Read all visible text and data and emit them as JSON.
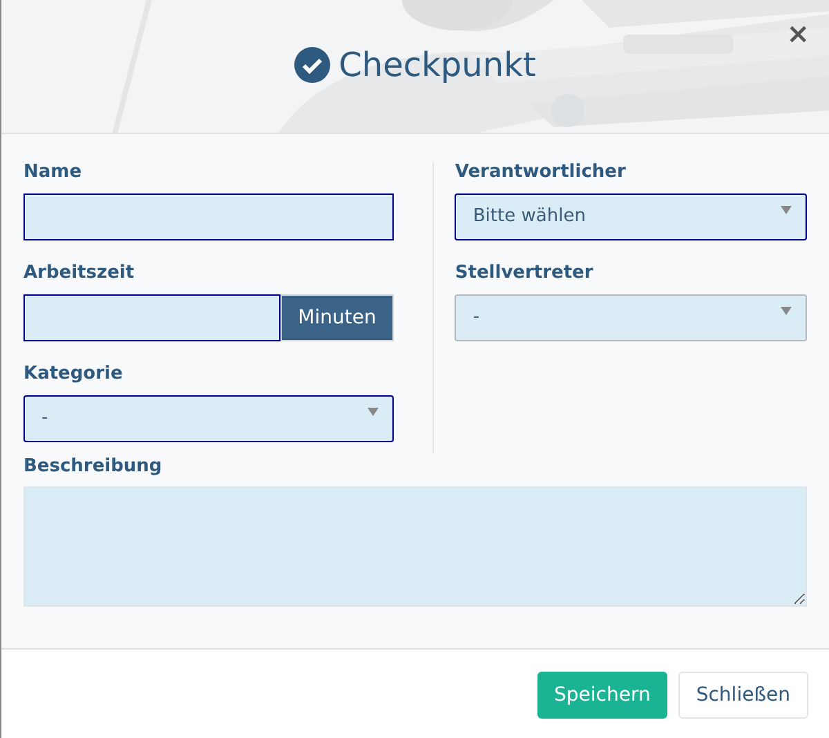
{
  "header": {
    "title": "Checkpunkt",
    "close": "×"
  },
  "left_fields": [
    {
      "kind": "input",
      "label": "Name",
      "highlighted": true
    },
    {
      "kind": "input_addon",
      "label": "Arbeitszeit",
      "addon": "Minuten",
      "highlighted": true
    },
    {
      "kind": "select",
      "label": "Kategorie",
      "value": "-",
      "highlighted": true
    }
  ],
  "right_fields": [
    {
      "kind": "select",
      "label": "Verantwortlicher",
      "value": "Bitte wählen",
      "highlighted": true
    },
    {
      "kind": "select",
      "label": "Stellvertreter",
      "value": "-",
      "highlighted": false
    }
  ],
  "description": {
    "label": "Beschreibung",
    "highlighted": false
  },
  "buttons": [
    {
      "label": "Speichern",
      "kind": "primary"
    },
    {
      "label": "Schließen",
      "kind": "default"
    }
  ]
}
